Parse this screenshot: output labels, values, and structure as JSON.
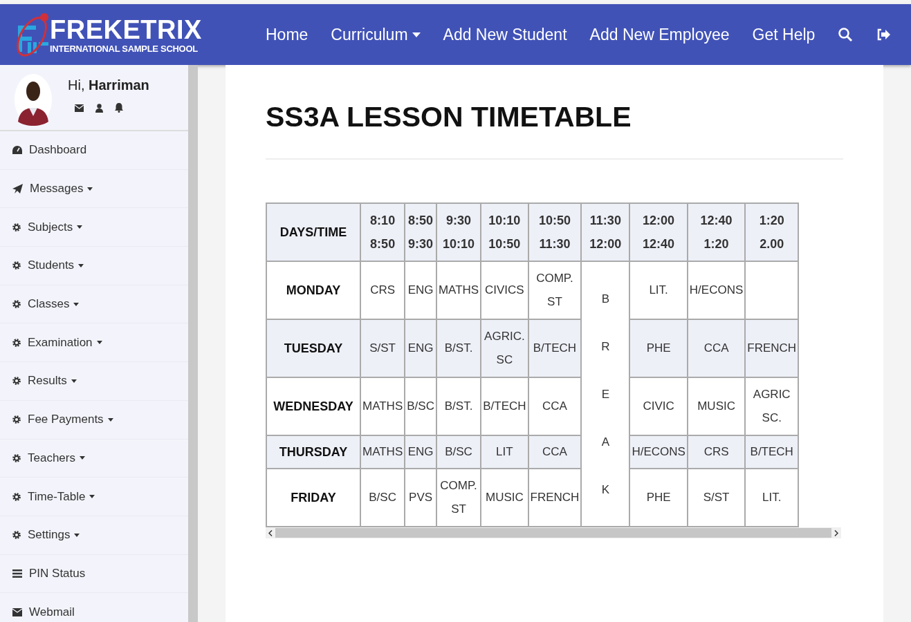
{
  "brand": {
    "name": "FREKETRIX",
    "tagline": "INTERNATIONAL SAMPLE SCHOOL"
  },
  "nav": [
    {
      "label": "Home",
      "dropdown": false
    },
    {
      "label": "Curriculum",
      "dropdown": true
    },
    {
      "label": "Add New Student",
      "dropdown": false
    },
    {
      "label": "Add New Employee",
      "dropdown": false
    },
    {
      "label": "Get Help",
      "dropdown": false
    }
  ],
  "user": {
    "greeting": "Hi, **Harriman**"
  },
  "sidebar": {
    "items": [
      {
        "label": "Dashboard",
        "kind": "dashboard",
        "dropdown": false
      },
      {
        "label": "Messages",
        "kind": "send",
        "dropdown": true
      },
      {
        "label": "Subjects",
        "kind": "gear",
        "dropdown": true
      },
      {
        "label": "Students",
        "kind": "gear",
        "dropdown": true
      },
      {
        "label": "Classes",
        "kind": "gear",
        "dropdown": true
      },
      {
        "label": "Examination",
        "kind": "gear",
        "dropdown": true
      },
      {
        "label": "Results",
        "kind": "gear",
        "dropdown": true
      },
      {
        "label": "Fee Payments",
        "kind": "gear",
        "dropdown": true
      },
      {
        "label": "Teachers",
        "kind": "gear",
        "dropdown": true
      },
      {
        "label": "Time-Table",
        "kind": "gear",
        "dropdown": true
      },
      {
        "label": "Settings",
        "kind": "gear",
        "dropdown": true
      },
      {
        "label": "PIN Status",
        "kind": "list",
        "dropdown": false
      },
      {
        "label": "Webmail",
        "kind": "mail",
        "dropdown": false
      }
    ]
  },
  "page": {
    "title": "SS3A LESSON TIMETABLE"
  },
  "timetable": {
    "corner": "DAYS/TIME",
    "times": [
      "8:10\n8:50",
      "8:50\n9:30",
      "9:30\n10:10",
      "10:10\n10:50",
      "10:50\n11:30",
      "11:30\n12:00",
      "12:00\n12:40",
      "12:40\n1:20",
      "1:20\n2.00"
    ],
    "break_label": "BREAK",
    "rows": [
      {
        "day": "MONDAY",
        "cells": [
          "CRS",
          "ENG",
          "MATHS",
          "CIVICS",
          "COMP.\nST",
          "LIT.",
          "H/ECONS",
          null
        ]
      },
      {
        "day": "TUESDAY",
        "cells": [
          "S/ST",
          "ENG",
          "B/ST.",
          "AGRIC.\nSC",
          "B/TECH",
          "PHE",
          "CCA",
          "FRENCH"
        ]
      },
      {
        "day": "WEDNESDAY",
        "cells": [
          "MATHS",
          "B/SC",
          "B/ST.",
          "B/TECH",
          "CCA",
          "CIVIC",
          "MUSIC",
          "AGRIC\nSC."
        ]
      },
      {
        "day": "THURSDAY",
        "cells": [
          "MATHS",
          "ENG",
          "B/SC",
          "LIT",
          "CCA",
          "H/ECONS",
          "CRS",
          "B/TECH"
        ]
      },
      {
        "day": "FRIDAY",
        "cells": [
          "B/SC",
          "PVS",
          "COMP.\nST",
          "MUSIC",
          "FRENCH",
          "PHE",
          "S/ST",
          "LIT."
        ]
      }
    ]
  }
}
